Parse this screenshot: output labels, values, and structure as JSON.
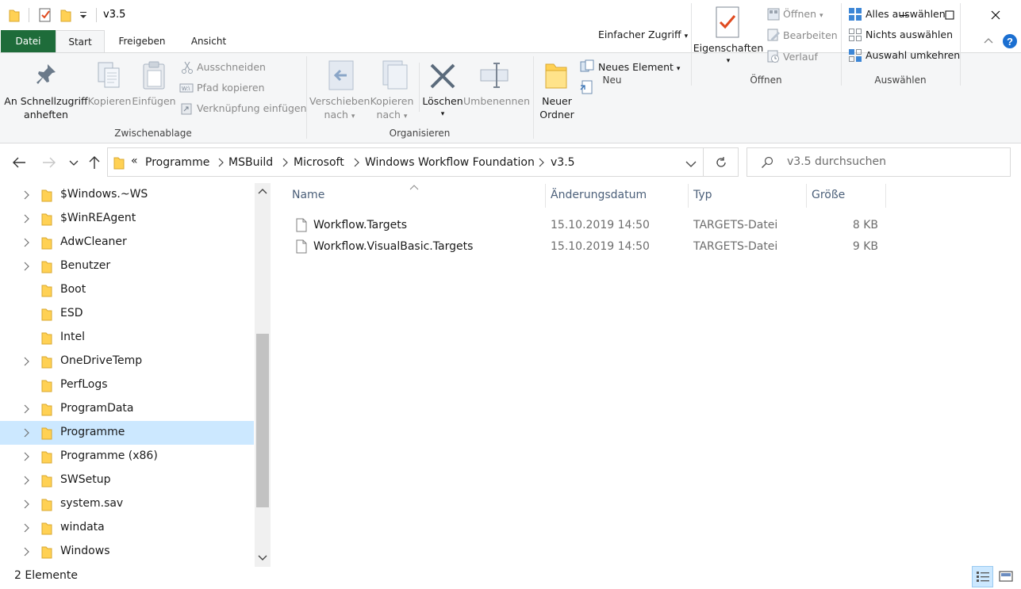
{
  "window": {
    "title": "v3.5"
  },
  "ribbon_tabs": [
    {
      "label": "Datei"
    },
    {
      "label": "Start"
    },
    {
      "label": "Freigeben"
    },
    {
      "label": "Ansicht"
    }
  ],
  "ribbon": {
    "clipboard": {
      "pin_label_1": "An Schnellzugriff",
      "pin_label_2": "anheften",
      "copy_label": "Kopieren",
      "paste_label": "Einfügen",
      "cut_label": "Ausschneiden",
      "copy_path_label": "Pfad kopieren",
      "paste_shortcut_label": "Verknüpfung einfügen",
      "group_label": "Zwischenablage"
    },
    "organize": {
      "move_label_1": "Verschieben",
      "move_label_2": "nach",
      "copyto_label_1": "Kopieren",
      "copyto_label_2": "nach",
      "delete_label": "Löschen",
      "rename_label": "Umbenennen",
      "group_label": "Organisieren"
    },
    "new": {
      "new_folder_label_1": "Neuer",
      "new_folder_label_2": "Ordner",
      "new_item_label": "Neues Element",
      "easy_access_label": "Einfacher Zugriff",
      "group_label": "Neu"
    },
    "open": {
      "properties_label": "Eigenschaften",
      "open_label": "Öffnen",
      "edit_label": "Bearbeiten",
      "history_label": "Verlauf",
      "group_label": "Öffnen"
    },
    "select": {
      "select_all_label": "Alles auswählen",
      "select_none_label": "Nichts auswählen",
      "invert_label": "Auswahl umkehren",
      "group_label": "Auswählen"
    }
  },
  "address": {
    "overflow": "«",
    "crumbs": [
      "Programme",
      "MSBuild",
      "Microsoft",
      "Windows Workflow Foundation",
      "v3.5"
    ]
  },
  "search": {
    "placeholder": "v3.5 durchsuchen"
  },
  "tree": [
    {
      "label": "$Windows.~WS",
      "expandable": true,
      "selected": false
    },
    {
      "label": "$WinREAgent",
      "expandable": true,
      "selected": false
    },
    {
      "label": "AdwCleaner",
      "expandable": true,
      "selected": false
    },
    {
      "label": "Benutzer",
      "expandable": true,
      "selected": false
    },
    {
      "label": "Boot",
      "expandable": false,
      "selected": false
    },
    {
      "label": "ESD",
      "expandable": false,
      "selected": false
    },
    {
      "label": "Intel",
      "expandable": false,
      "selected": false
    },
    {
      "label": "OneDriveTemp",
      "expandable": true,
      "selected": false
    },
    {
      "label": "PerfLogs",
      "expandable": false,
      "selected": false
    },
    {
      "label": "ProgramData",
      "expandable": true,
      "selected": false
    },
    {
      "label": "Programme",
      "expandable": true,
      "selected": true
    },
    {
      "label": "Programme (x86)",
      "expandable": true,
      "selected": false
    },
    {
      "label": "SWSetup",
      "expandable": true,
      "selected": false
    },
    {
      "label": "system.sav",
      "expandable": true,
      "selected": false
    },
    {
      "label": "windata",
      "expandable": true,
      "selected": false
    },
    {
      "label": "Windows",
      "expandable": true,
      "selected": false
    }
  ],
  "columns": {
    "name": "Name",
    "date": "Änderungsdatum",
    "type": "Typ",
    "size": "Größe"
  },
  "files": [
    {
      "name": "Workflow.Targets",
      "date": "15.10.2019 14:50",
      "type": "TARGETS-Datei",
      "size": "8 KB"
    },
    {
      "name": "Workflow.VisualBasic.Targets",
      "date": "15.10.2019 14:50",
      "type": "TARGETS-Datei",
      "size": "9 KB"
    }
  ],
  "status": {
    "count_text": "2 Elemente"
  },
  "colors": {
    "file_tab": "#1e6c3a",
    "selection": "#cce8ff",
    "help_blue": "#1b6fd1",
    "folder_yellow": "#ffd154"
  }
}
